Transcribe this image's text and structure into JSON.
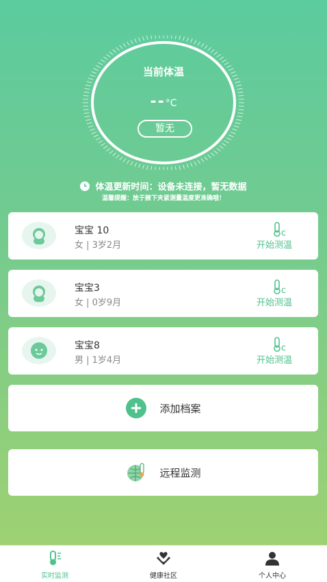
{
  "gauge": {
    "title": "当前体温",
    "value": "--",
    "unit": "°C",
    "badge": "暂无"
  },
  "update": {
    "text": "体温更新时间：设备未连接，暂无数据",
    "tip": "温馨提醒：放于腋下夹紧测量温度更准确哦！"
  },
  "babies": [
    {
      "name": "宝宝 10",
      "info": "女 | 3岁2月",
      "action": "开始测温"
    },
    {
      "name": "宝宝3",
      "info": "女 | 0岁9月",
      "action": "开始测温"
    },
    {
      "name": "宝宝8",
      "info": "男 | 1岁4月",
      "action": "开始测温"
    }
  ],
  "actions": {
    "add_profile": "添加档案",
    "remote_monitor": "远程监测"
  },
  "tabs": [
    {
      "label": "实时监测",
      "icon": "thermometer-icon",
      "active": true
    },
    {
      "label": "健康社区",
      "icon": "hands-heart-icon",
      "active": false
    },
    {
      "label": "个人中心",
      "icon": "person-icon",
      "active": false
    }
  ],
  "colors": {
    "accent": "#4fc18d",
    "gradient_top": "#5ccb9e",
    "gradient_bottom": "#a3d26f"
  }
}
